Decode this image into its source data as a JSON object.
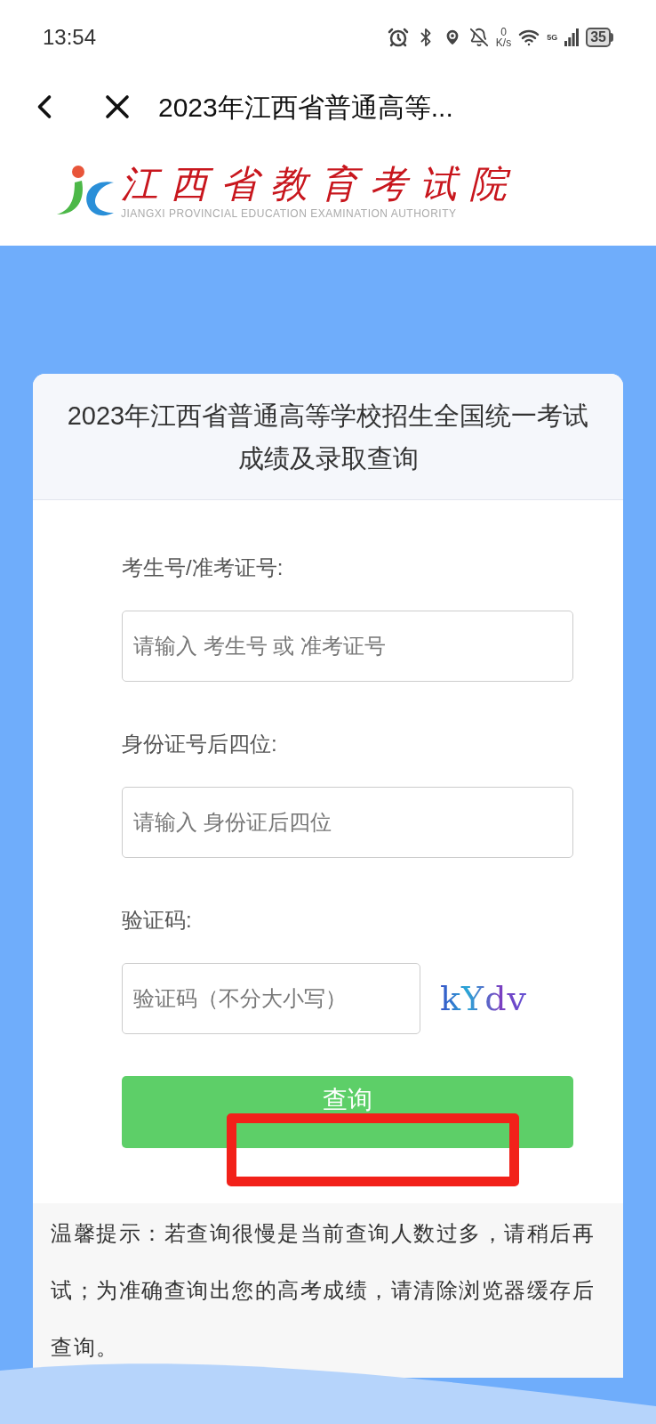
{
  "status_bar": {
    "time": "13:54",
    "net_speed_value": "0",
    "net_speed_unit": "K/s",
    "network": "5G",
    "battery": "35"
  },
  "nav_bar": {
    "title": "2023年江西省普通高等..."
  },
  "logo": {
    "name": "江西省教育考试院",
    "subtitle": "JIANGXI PROVINCIAL EDUCATION EXAMINATION AUTHORITY"
  },
  "form": {
    "title": "2023年江西省普通高等学校招生全国统一考试成绩及录取查询",
    "fields": [
      {
        "kind": "text",
        "label": "考生号/准考证号:",
        "placeholder": "请输入 考生号 或 准考证号"
      },
      {
        "kind": "text",
        "label": "身份证号后四位:",
        "placeholder": "请输入 身份证后四位"
      },
      {
        "kind": "captcha",
        "label": "验证码:",
        "placeholder": "验证码（不分大小写）",
        "captcha": "kYdv"
      }
    ],
    "submit": "查询",
    "highlighted": true,
    "tip": "温馨提示：若查询很慢是当前查询人数过多，请稍后再试；为准确查询出您的高考成绩，请清除浏览器缓存后查询。"
  }
}
